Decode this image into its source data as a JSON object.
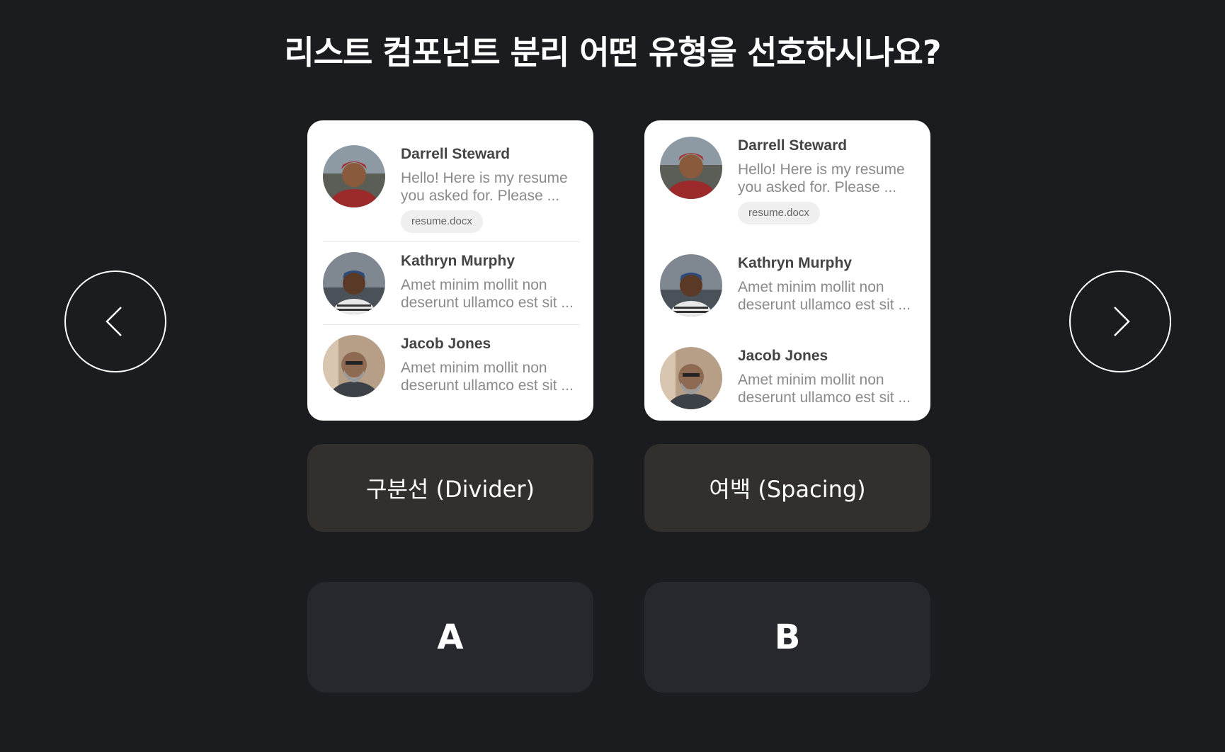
{
  "title": "리스트 컴포넌트 분리 어떤 유형을 선호하시나요?",
  "nav": {
    "prev_icon": "chevron-left-icon",
    "next_icon": "chevron-right-icon"
  },
  "options": [
    {
      "id": "a",
      "label": "구분선 (Divider)",
      "vote": "A",
      "items": [
        {
          "name": "Darrell Steward",
          "line1": "Hello! Here is my resume",
          "line2": "you asked for. Please ...",
          "attachment": "resume.docx"
        },
        {
          "name": "Kathryn Murphy",
          "line1": "Amet minim mollit non",
          "line2": "deserunt ullamco est sit ..."
        },
        {
          "name": "Jacob Jones",
          "line1": "Amet minim mollit non",
          "line2": "deserunt ullamco est sit ..."
        }
      ]
    },
    {
      "id": "b",
      "label": "여백 (Spacing)",
      "vote": "B",
      "items": [
        {
          "name": "Darrell Steward",
          "line1": "Hello! Here is my resume",
          "line2": "you asked for. Please ...",
          "attachment": "resume.docx"
        },
        {
          "name": "Kathryn Murphy",
          "line1": "Amet minim mollit non",
          "line2": "deserunt ullamco est sit ..."
        },
        {
          "name": "Jacob Jones",
          "line1": "Amet minim mollit non",
          "line2": "deserunt ullamco est sit ..."
        }
      ]
    }
  ],
  "colors": {
    "background": "#1b1c20",
    "label_box": "#322f2c",
    "vote_button": "#27282d",
    "card": "#ffffff"
  }
}
